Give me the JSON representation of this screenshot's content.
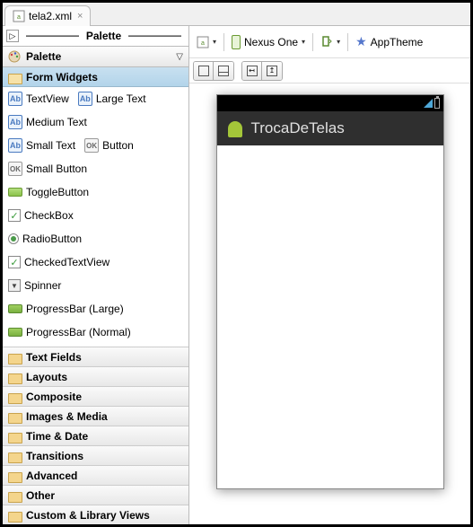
{
  "tab": {
    "filename": "tela2.xml",
    "close": "×"
  },
  "palette": {
    "toggle": "▷",
    "title": "Palette",
    "subtitle": "Palette",
    "chevron": "▽"
  },
  "form_widgets_label": "Form Widgets",
  "widgets": {
    "textview": "TextView",
    "large_text": "Large Text",
    "medium_text": "Medium Text",
    "small_text": "Small Text",
    "button": "Button",
    "small_button": "Small Button",
    "toggle_button": "ToggleButton",
    "checkbox": "CheckBox",
    "radio_button": "RadioButton",
    "checked_textview": "CheckedTextView",
    "spinner": "Spinner",
    "progress_large": "ProgressBar (Large)",
    "progress_normal": "ProgressBar (Normal)"
  },
  "categories": {
    "text_fields": "Text Fields",
    "layouts": "Layouts",
    "composite": "Composite",
    "images_media": "Images & Media",
    "time_date": "Time & Date",
    "transitions": "Transitions",
    "advanced": "Advanced",
    "other": "Other",
    "custom_library": "Custom & Library Views"
  },
  "toolbar": {
    "device": "Nexus One",
    "theme": "AppTheme"
  },
  "phone": {
    "app_title": "TrocaDeTelas"
  },
  "icon_text": {
    "ab": "Ab",
    "ok": "OK",
    "check": "✓",
    "down": "▼",
    "left": "↤",
    "up": "↥"
  }
}
